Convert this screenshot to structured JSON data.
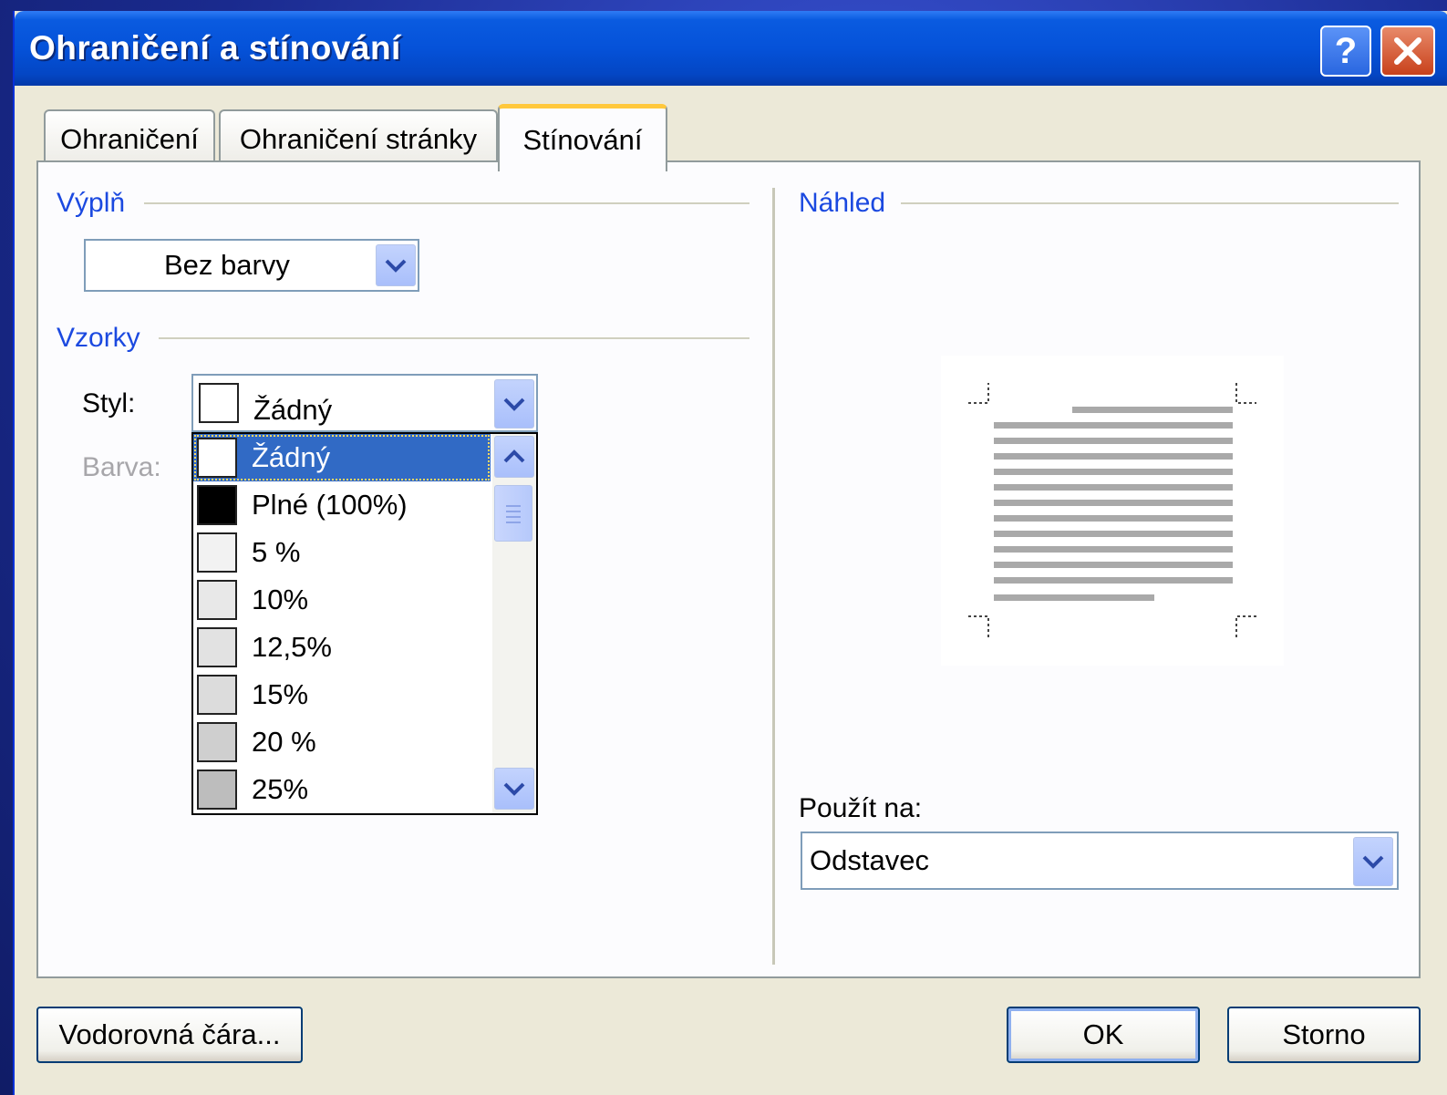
{
  "dialog": {
    "title": "Ohraničení a stínování",
    "help_glyph": "?",
    "tabs": [
      "Ohraničení",
      "Ohraničení stránky",
      "Stínování"
    ],
    "active_tab": 2
  },
  "fill": {
    "group_label": "Výplň",
    "color_value": "Bez barvy"
  },
  "patterns": {
    "group_label": "Vzorky",
    "style_label": "Styl:",
    "style_value": "Žádný",
    "color_label": "Barva:",
    "options": [
      {
        "label": "Žádný",
        "swatch": "#ffffff",
        "selected": true
      },
      {
        "label": "Plné (100%)",
        "swatch": "#000000"
      },
      {
        "label": "5 %",
        "swatch": "#f2f2f2"
      },
      {
        "label": "10%",
        "swatch": "#e8e8e8"
      },
      {
        "label": "12,5%",
        "swatch": "#e2e2e2"
      },
      {
        "label": "15%",
        "swatch": "#dcdcdc"
      },
      {
        "label": "20 %",
        "swatch": "#cfcfcf"
      },
      {
        "label": "25%",
        "swatch": "#bdbdbd"
      }
    ]
  },
  "preview": {
    "group_label": "Náhled",
    "apply_label": "Použít na:",
    "apply_value": "Odstavec"
  },
  "buttons": {
    "horizontal_line": "Vodorovná čára...",
    "ok": "OK",
    "cancel": "Storno"
  },
  "colors": {
    "titlebar": "#0552d9",
    "group_text": "#1b49e0",
    "selection": "#316ac5",
    "active_tab_accent": "#ffc83c",
    "dialog_bg": "#ece9d8"
  }
}
